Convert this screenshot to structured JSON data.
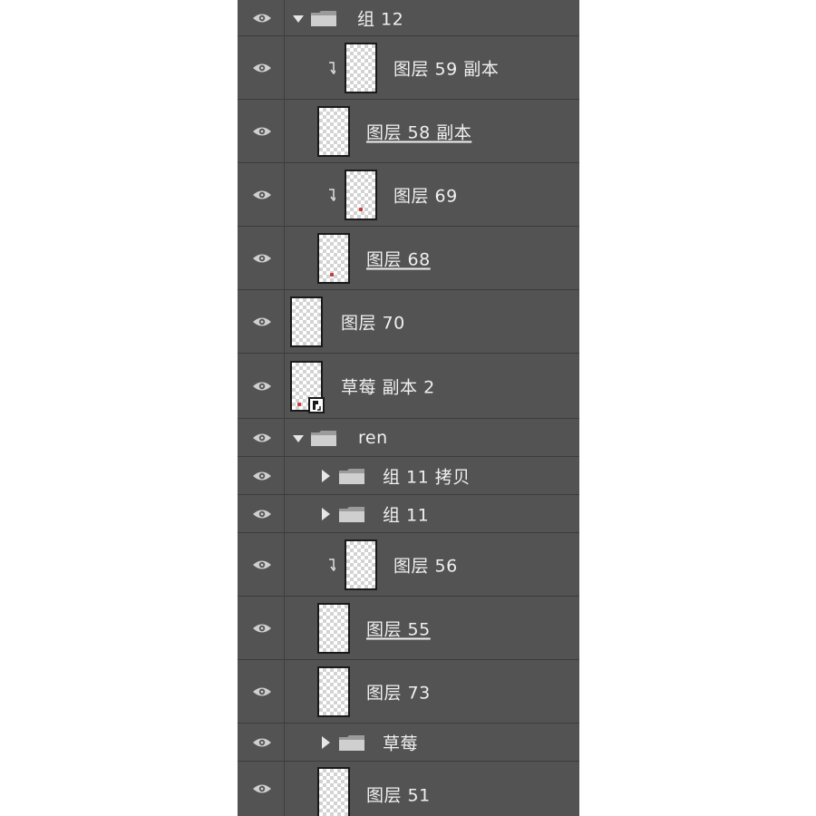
{
  "layers": [
    {
      "type": "group",
      "expanded": true,
      "label": "组 12"
    },
    {
      "type": "layer",
      "clipped": true,
      "label": "图层 59 副本"
    },
    {
      "type": "layer",
      "underline": true,
      "label": "图层 58 副本"
    },
    {
      "type": "layer",
      "clipped": true,
      "label": "图层 69"
    },
    {
      "type": "layer",
      "underline": true,
      "label": "图层 68"
    },
    {
      "type": "layer",
      "label": "图层 70"
    },
    {
      "type": "smart",
      "label": "草莓 副本 2"
    },
    {
      "type": "group",
      "expanded": true,
      "label": "ren"
    },
    {
      "type": "group",
      "expanded": false,
      "label": "组 11 拷贝"
    },
    {
      "type": "group",
      "expanded": false,
      "label": "组 11"
    },
    {
      "type": "layer",
      "clipped": true,
      "label": "图层 56"
    },
    {
      "type": "layer",
      "underline": true,
      "label": "图层 55"
    },
    {
      "type": "layer",
      "label": "图层 73"
    },
    {
      "type": "group",
      "expanded": false,
      "label": "草莓"
    },
    {
      "type": "layer",
      "label": "图层 51"
    }
  ],
  "icons": {
    "visibility": "eye-icon",
    "group": "folder-icon",
    "expanded": "triangle-down-icon",
    "collapsed": "triangle-right-icon",
    "clipping": "clipping-mask-arrow-icon",
    "smart_object": "smart-object-badge-icon"
  },
  "colors": {
    "panel_bg": "#535353",
    "divider": "#3c3c3c",
    "text": "#f0f0f0"
  }
}
